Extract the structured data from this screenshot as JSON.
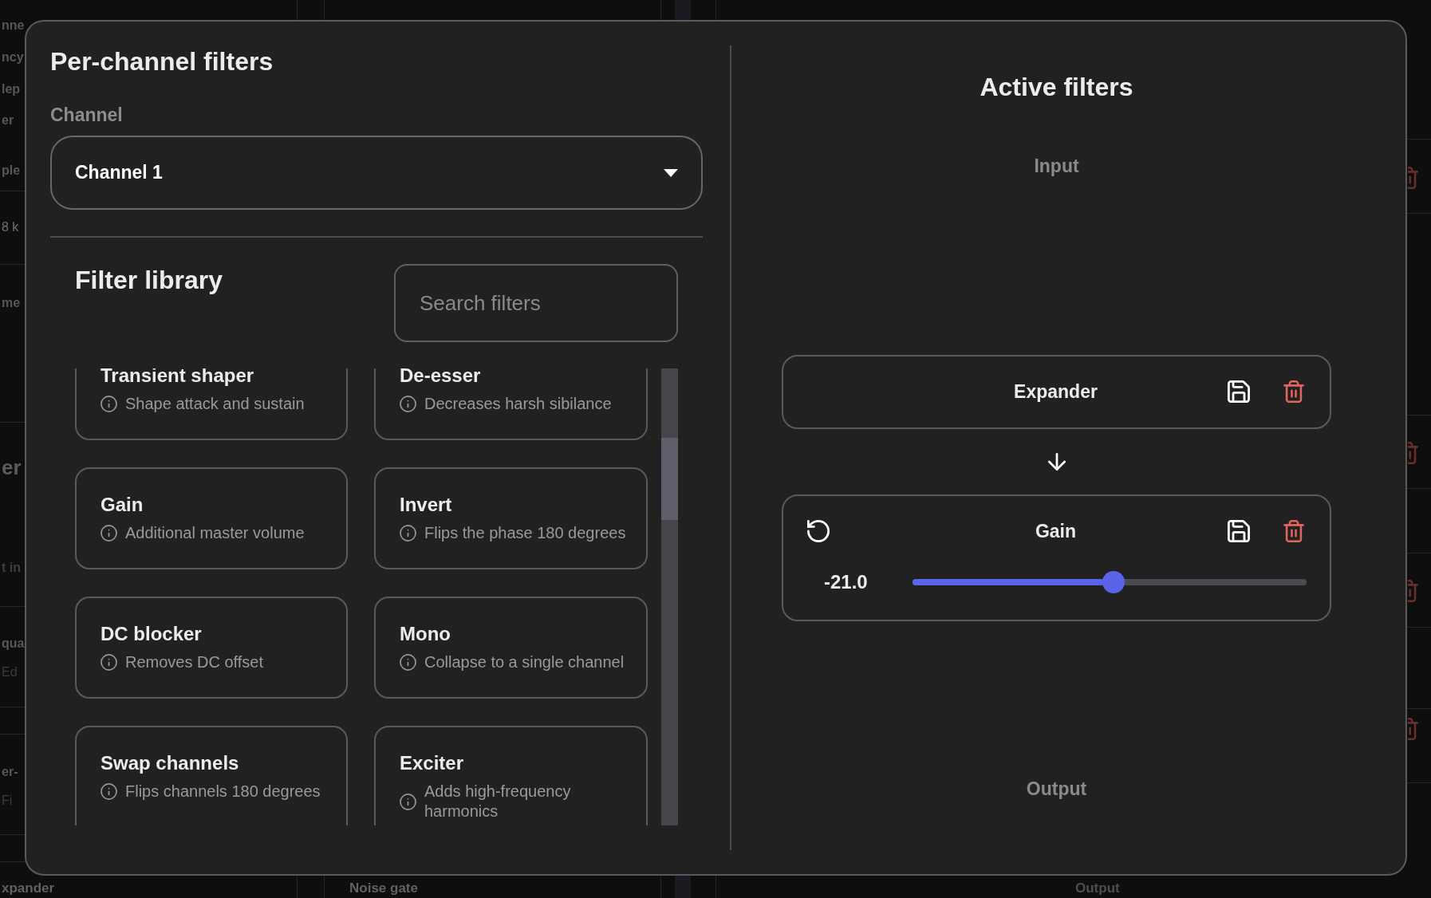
{
  "background": {
    "left_rows": [
      {
        "texts": [
          {
            "text": "nne",
            "kind": "label"
          },
          {
            "text": "ncy",
            "kind": "label"
          },
          {
            "text": "lep",
            "kind": "label"
          },
          {
            "text": "er",
            "kind": "label"
          },
          {
            "text": "ple",
            "kind": "label"
          }
        ]
      },
      {
        "texts": [
          {
            "text": "8 k",
            "kind": "value"
          }
        ]
      },
      {
        "texts": [
          {
            "text": "me",
            "kind": "label"
          }
        ]
      },
      {
        "texts": [
          {
            "text": "er",
            "kind": "heading"
          },
          {
            "text": "t in",
            "kind": "hint"
          }
        ]
      },
      {
        "texts": [
          {
            "text": "qua",
            "kind": "label"
          },
          {
            "text": "Ed",
            "kind": "description"
          }
        ]
      },
      {
        "texts": [
          {
            "text": "er-",
            "kind": "label"
          },
          {
            "text": "Fi",
            "kind": "description"
          }
        ]
      }
    ],
    "bottom_texts": [
      "xpander",
      "Noise gate",
      "Output"
    ]
  },
  "dialog": {
    "title": "Per-channel filters",
    "channel_label": "Channel",
    "channel_select": {
      "value": "Channel 1"
    },
    "library": {
      "title": "Filter library",
      "search": {
        "placeholder": "Search filters"
      },
      "filters": [
        {
          "name": "Transient shaper",
          "description": "Shape attack and sustain"
        },
        {
          "name": "De-esser",
          "description": "Decreases harsh sibilance"
        },
        {
          "name": "Gain",
          "description": "Additional master volume"
        },
        {
          "name": "Invert",
          "description": "Flips the phase 180 degrees"
        },
        {
          "name": "DC blocker",
          "description": "Removes DC offset"
        },
        {
          "name": "Mono",
          "description": "Collapse to a single channel"
        },
        {
          "name": "Swap channels",
          "description": "Flips channels 180 degrees"
        },
        {
          "name": "Exciter",
          "description": "Adds high-frequency harmonics"
        }
      ]
    },
    "active": {
      "title": "Active filters",
      "input_label": "Input",
      "chain": [
        {
          "name": "Expander",
          "kind": "plain"
        },
        {
          "name": "Gain",
          "kind": "slider",
          "reading": "-21.0",
          "level": 0.51
        }
      ],
      "output_label": "Output"
    }
  }
}
